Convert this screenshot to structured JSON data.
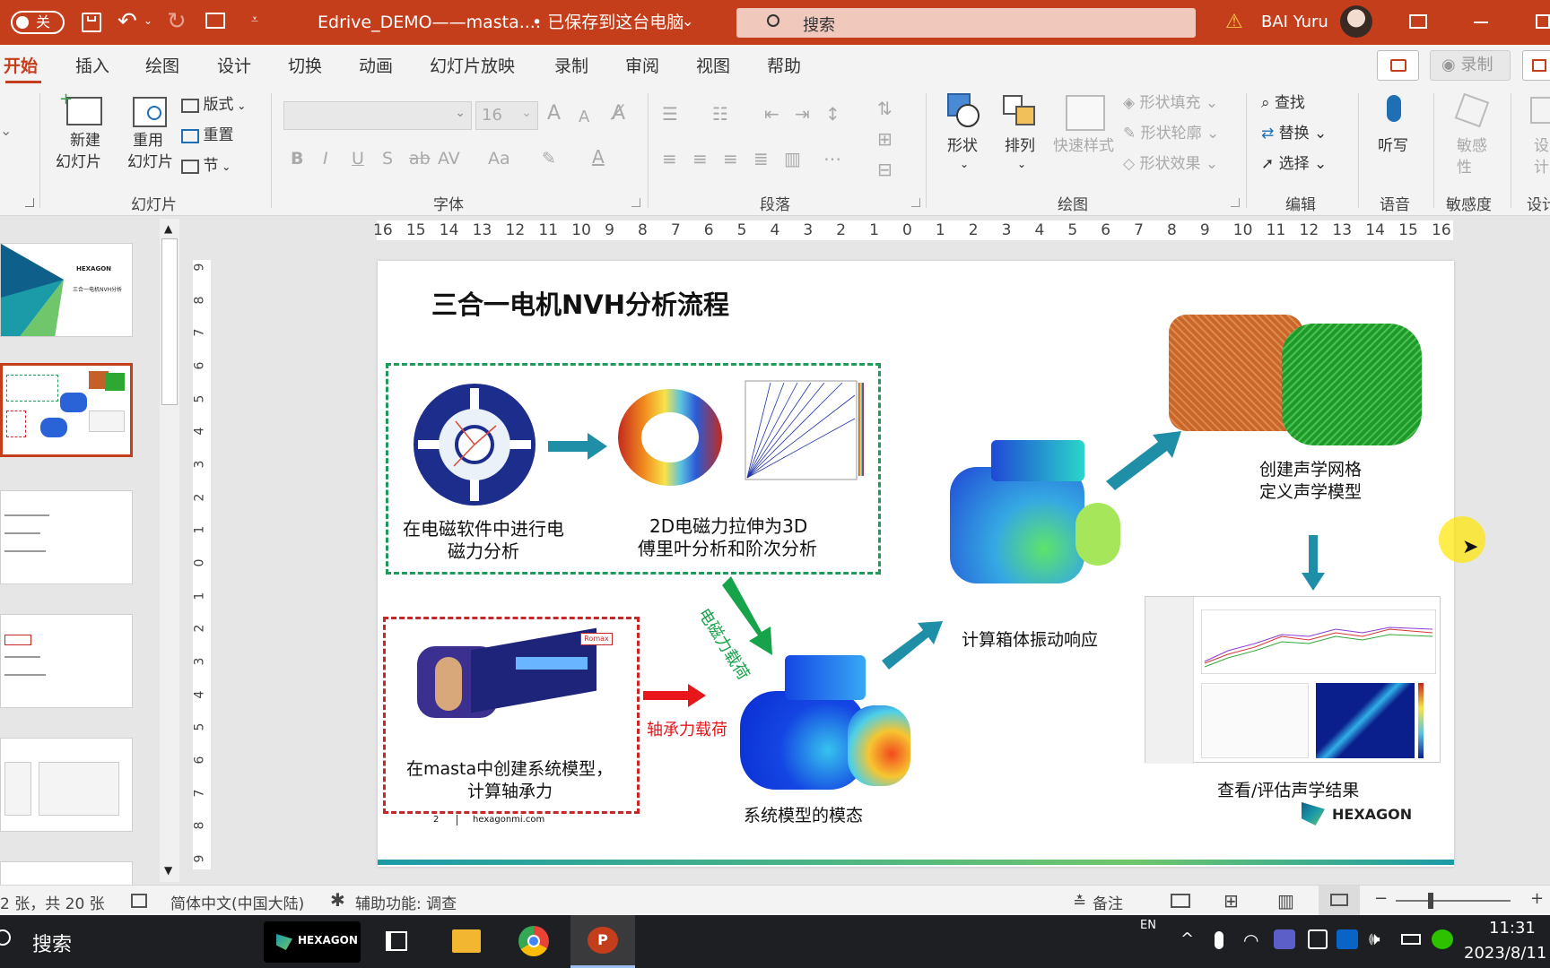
{
  "titlebar": {
    "autosave_label": "关",
    "doc_title": "Edrive_DEMO——masta....",
    "saved_status": "• 已保存到这台电脑",
    "search_placeholder": "搜索",
    "user_name": "BAI Yuru"
  },
  "tabs": [
    "开始",
    "插入",
    "绘图",
    "设计",
    "切换",
    "动画",
    "幻灯片放映",
    "录制",
    "审阅",
    "视图",
    "帮助"
  ],
  "ribbon_right": {
    "record_button": "录制"
  },
  "ribbon": {
    "slides_group": {
      "label": "幻灯片",
      "new_slide": [
        "新建",
        "幻灯片"
      ],
      "reuse_slide": [
        "重用",
        "幻灯片"
      ],
      "layout": "版式",
      "reset": "重置",
      "section": "节"
    },
    "font_group": {
      "label": "字体",
      "font_size": "16",
      "bold": "B",
      "italic": "I",
      "underline": "U",
      "shadow": "S",
      "strike": "ab",
      "spacing": "AV",
      "case": "Aa",
      "grow": "A",
      "shrink": "A"
    },
    "paragraph_group": {
      "label": "段落"
    },
    "drawing_group": {
      "label": "绘图",
      "shapes": "形状",
      "arrange": "排列",
      "quick_styles": "快速样式",
      "fill": "形状填充",
      "outline": "形状轮廓",
      "effects": "形状效果"
    },
    "editing_group": {
      "label": "编辑",
      "find": "查找",
      "replace": "替换",
      "select": "选择"
    },
    "voice_group": {
      "label": "语音",
      "dictate": "听写"
    },
    "sensitivity_group": {
      "label": "敏感度",
      "sensitivity": [
        "敏感",
        "性"
      ]
    },
    "designer_group": {
      "label": "设计",
      "designer": [
        "设",
        "计"
      ]
    }
  },
  "ruler": {
    "h_ticks": [
      "16",
      "15",
      "14",
      "13",
      "12",
      "11",
      "10",
      "9",
      "8",
      "7",
      "6",
      "5",
      "4",
      "3",
      "2",
      "1",
      "0",
      "1",
      "2",
      "3",
      "4",
      "5",
      "6",
      "7",
      "8",
      "9",
      "10",
      "11",
      "12",
      "13",
      "14",
      "15",
      "16"
    ],
    "v_ticks": [
      "9",
      "8",
      "7",
      "6",
      "5",
      "4",
      "3",
      "2",
      "1",
      "0",
      "1",
      "2",
      "3",
      "4",
      "5",
      "6",
      "7",
      "8",
      "9"
    ]
  },
  "thumbs": {
    "slide1": {
      "brand": "HEXAGON",
      "title": "三合一电机NVH分析"
    }
  },
  "slide": {
    "title": "三合一电机NVH分析流程",
    "em_caption": [
      "在电磁软件中进行电",
      "磁力分析"
    ],
    "fourier_caption": [
      "2D电磁力拉伸为3D",
      "傅里叶分析和阶次分析"
    ],
    "masta_caption": [
      "在masta中创建系统模型，",
      "计算轴承力"
    ],
    "em_load_label": "电磁力载荷",
    "bearing_load_label": "轴承力载荷",
    "modal_caption": "系统模型的模态",
    "housing_caption": "计算箱体振动响应",
    "acoustic_caption": [
      "创建声学网格",
      "定义声学模型"
    ],
    "results_caption": "查看/评估声学结果",
    "page_number": "2",
    "footer_url": "hexagonmi.com",
    "logo_text": "HEXAGON",
    "romax_badge": "Romax"
  },
  "statusbar": {
    "slide_count": "2 张，共 20 张",
    "language": "简体中文(中国大陆)",
    "accessibility": "辅助功能: 调查",
    "notes": "备注"
  },
  "taskbar": {
    "search_label": "搜索",
    "hexagon_app": "HEXAGON",
    "ime": "EN",
    "time": "11:31",
    "date": "2023/8/11"
  },
  "colors": {
    "titlebar": "#c43e1c",
    "green_dash": "#1e9a5a",
    "red_dash": "#c62828",
    "teal_arrow": "#1f8fa8",
    "red_arrow": "#e8161b",
    "green_arrow": "#17a34a"
  }
}
